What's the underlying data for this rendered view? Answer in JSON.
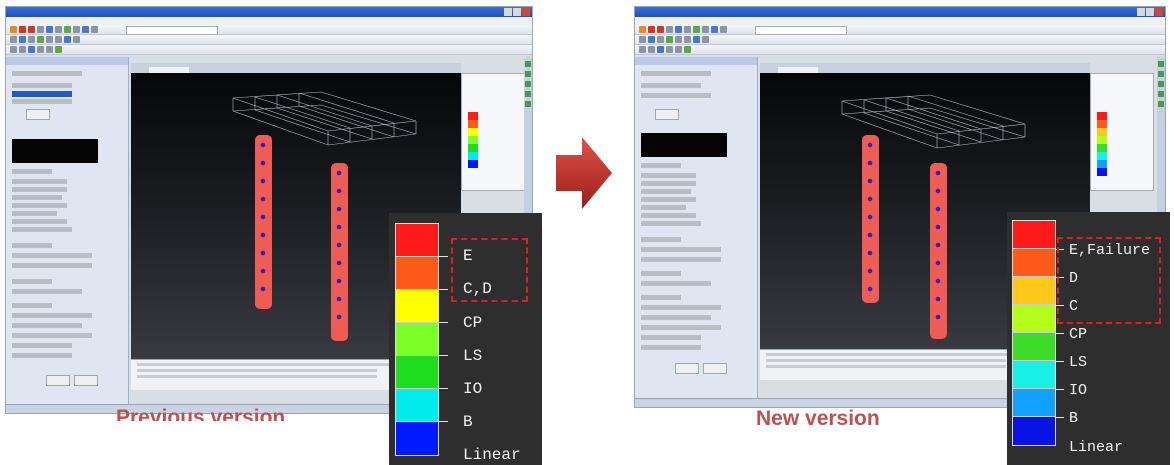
{
  "captions": {
    "left": "Previous version",
    "right": "New version"
  },
  "legend_left": {
    "entries": [
      {
        "label": "E",
        "color": "#ff1a1a"
      },
      {
        "label": "C,D",
        "color": "#ff5a1a"
      },
      {
        "label": "CP",
        "color": "#ffff00"
      },
      {
        "label": "LS",
        "color": "#7dff2a"
      },
      {
        "label": "IO",
        "color": "#1edc1e"
      },
      {
        "label": "B",
        "color": "#00ecec"
      },
      {
        "label": "Linear",
        "color": "#0019ff"
      }
    ],
    "highlighted": [
      "E",
      "C,D"
    ]
  },
  "legend_right": {
    "entries": [
      {
        "label": "E,Failure",
        "color": "#ff1a1a"
      },
      {
        "label": "D",
        "color": "#ff5a1a"
      },
      {
        "label": "C",
        "color": "#ffc81a"
      },
      {
        "label": "CP",
        "color": "#b4ff1a"
      },
      {
        "label": "LS",
        "color": "#3cdc28"
      },
      {
        "label": "IO",
        "color": "#1af0e6"
      },
      {
        "label": "B",
        "color": "#14a0ff"
      },
      {
        "label": "Linear",
        "color": "#0a14e6"
      }
    ],
    "highlighted": [
      "E,Failure",
      "D",
      "C"
    ]
  },
  "colors": {
    "caption": "#c0504d",
    "highlight_border": "#e01e1e",
    "arrow": "#c0392b",
    "column_fill": "#ee5d55",
    "hinge_dot": "#3a1fb0",
    "viewport_bg": "#1a1c20"
  },
  "icons": {
    "transition": "right-arrow-icon"
  }
}
